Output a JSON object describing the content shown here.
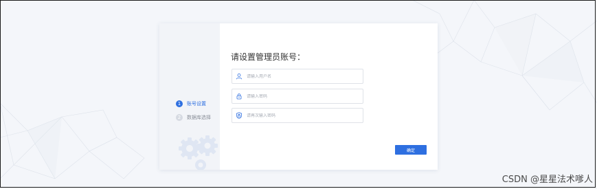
{
  "sidebar": {
    "steps": [
      {
        "number": "1",
        "label": "账号设置",
        "state": "active"
      },
      {
        "number": "2",
        "label": "数据库选择",
        "state": "inactive"
      }
    ]
  },
  "form": {
    "title": "请设置管理员账号：",
    "username": {
      "placeholder": "请输入用户名",
      "value": "",
      "icon": "user-icon"
    },
    "password": {
      "placeholder": "请输入密码",
      "value": "",
      "icon": "lock-icon"
    },
    "password_confirm": {
      "placeholder": "请再次输入密码",
      "value": "",
      "icon": "lock-check-icon"
    },
    "confirm_label": "确定"
  },
  "watermark": "CSDN @星星法术嗲人",
  "colors": {
    "accent": "#2e6fe0",
    "background": "#f4f6fa",
    "border": "#dfe2e8"
  }
}
